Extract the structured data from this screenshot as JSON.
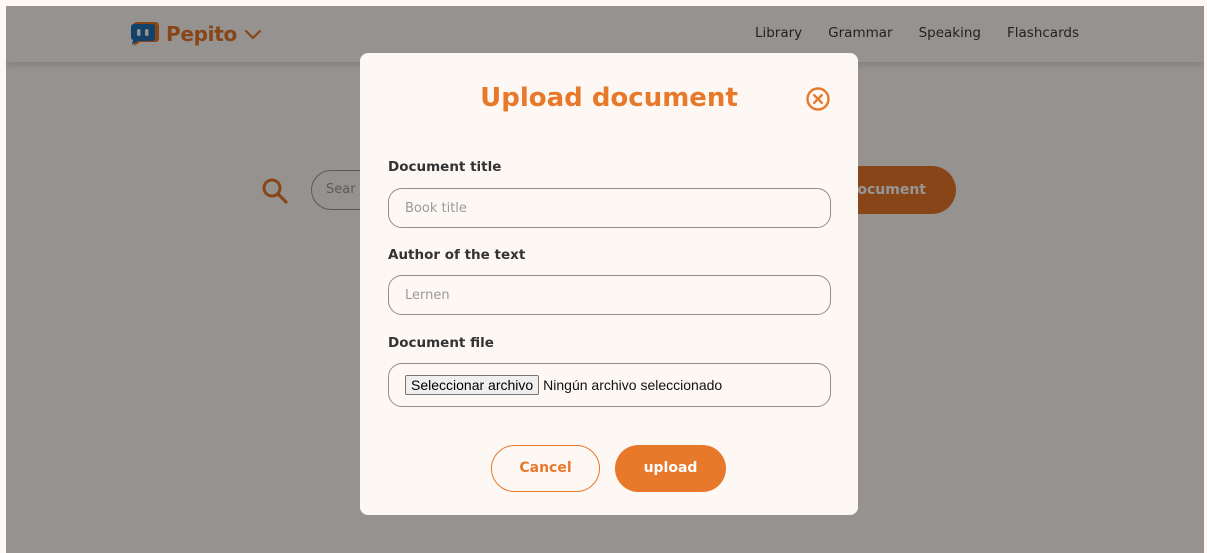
{
  "header": {
    "brand": "Pepito",
    "nav": [
      {
        "label": "Library"
      },
      {
        "label": "Grammar"
      },
      {
        "label": "Speaking"
      },
      {
        "label": "Flashcards"
      }
    ]
  },
  "background": {
    "search_placeholder": "Sear",
    "upload_button_label": "ocument"
  },
  "modal": {
    "title": "Upload document",
    "fields": {
      "title_label": "Document title",
      "title_placeholder": "Book title",
      "author_label": "Author of the text",
      "author_placeholder": "Lernen",
      "file_label": "Document file",
      "file_button": "Seleccionar archivo",
      "file_status": "Ningún archivo seleccionado"
    },
    "cancel_label": "Cancel",
    "upload_label": "upload"
  },
  "icons": {
    "logo": "robot-face-icon",
    "brand_menu": "chevron-down-icon",
    "search": "search-icon",
    "close": "close-circle-icon"
  },
  "colors": {
    "accent": "#e8782a",
    "logo_blue": "#1f6fb5",
    "background": "#fdf8f4",
    "overlay": "rgba(0,0,0,0.41)"
  }
}
